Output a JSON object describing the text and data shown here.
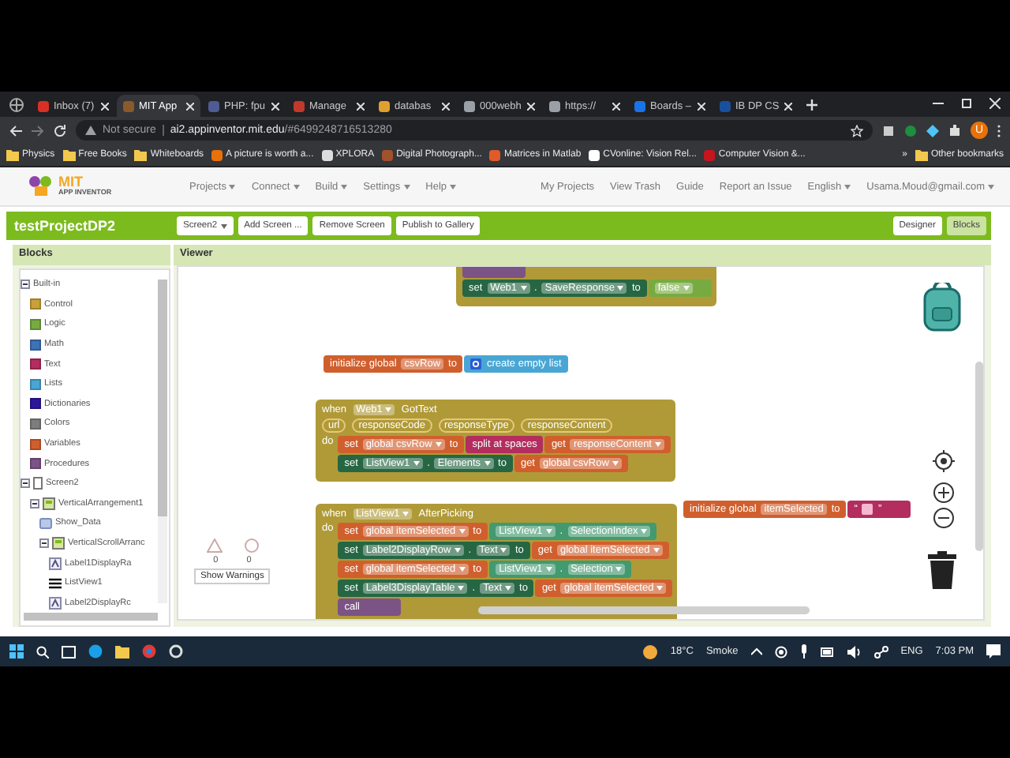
{
  "browser": {
    "tabs": [
      {
        "title": "Inbox (7)",
        "selected": false,
        "color": "#d93025"
      },
      {
        "title": "MIT App",
        "selected": true,
        "color": "#8a5a2b"
      },
      {
        "title": "PHP: fpu",
        "selected": false,
        "color": "#4f5b93"
      },
      {
        "title": "Manage",
        "selected": false,
        "color": "#c0392b"
      },
      {
        "title": "databas",
        "selected": false,
        "color": "#e0a030"
      },
      {
        "title": "000webh",
        "selected": false,
        "color": "#9aa0a6"
      },
      {
        "title": "https://",
        "selected": false,
        "color": "#9aa0a6"
      },
      {
        "title": "Boards –",
        "selected": false,
        "color": "#1a73e8"
      },
      {
        "title": "IB DP CS",
        "selected": false,
        "color": "#1a4f9c"
      }
    ],
    "security": "Not secure",
    "url_host": "ai2.appinventor.mit.edu",
    "url_rest": "/#6499248716513280",
    "profile": "U",
    "bookmarks": [
      {
        "label": "Physics",
        "kind": "folder"
      },
      {
        "label": "Free Books",
        "kind": "folder"
      },
      {
        "label": "Whiteboards",
        "kind": "folder"
      },
      {
        "label": "A picture is worth a...",
        "kind": "site",
        "color": "#e8710a"
      },
      {
        "label": "XPLORA",
        "kind": "site",
        "color": "#dddddd"
      },
      {
        "label": "Digital Photograph...",
        "kind": "site",
        "color": "#a0522d"
      },
      {
        "label": "Matrices in Matlab",
        "kind": "site",
        "color": "#e05a2a"
      },
      {
        "label": "CVonline: Vision Rel...",
        "kind": "site",
        "color": "#ffffff"
      },
      {
        "label": "Computer Vision &...",
        "kind": "site",
        "color": "#c4161c"
      }
    ],
    "more": "»",
    "other": "Other bookmarks"
  },
  "app": {
    "logo_top": "MIT",
    "logo_bottom": "APP INVENTOR",
    "menus": [
      "Projects",
      "Connect",
      "Build",
      "Settings",
      "Help"
    ],
    "links": [
      "My Projects",
      "View Trash",
      "Guide",
      "Report an Issue"
    ],
    "language": "English",
    "account": "Usama.Moud@gmail.com",
    "project": "testProjectDP2",
    "screen": "Screen2",
    "actions": [
      "Add Screen ...",
      "Remove Screen",
      "Publish to Gallery"
    ],
    "modes": [
      {
        "label": "Designer",
        "selected": false
      },
      {
        "label": "Blocks",
        "selected": true
      }
    ]
  },
  "blocks_panel": {
    "title": "Blocks",
    "tree": [
      {
        "label": "Built-in",
        "expanded": true,
        "kind": "root",
        "children": [
          {
            "label": "Control",
            "kind": "category",
            "color": "#c8a13a"
          },
          {
            "label": "Logic",
            "kind": "category",
            "color": "#77ab41"
          },
          {
            "label": "Math",
            "kind": "category",
            "color": "#3f71b5"
          },
          {
            "label": "Text",
            "kind": "category",
            "color": "#b32d5e"
          },
          {
            "label": "Lists",
            "kind": "category",
            "color": "#49a6d4"
          },
          {
            "label": "Dictionaries",
            "kind": "category",
            "color": "#2d1799"
          },
          {
            "label": "Colors",
            "kind": "category",
            "color": "#7d7d7d"
          },
          {
            "label": "Variables",
            "kind": "category",
            "color": "#d05f2d"
          },
          {
            "label": "Procedures",
            "kind": "category",
            "color": "#7c5385"
          }
        ]
      },
      {
        "label": "Screen2",
        "expanded": true,
        "kind": "screen",
        "children": [
          {
            "label": "VerticalArrangement1",
            "expanded": true,
            "kind": "arrangement",
            "children": [
              {
                "label": "Show_Data",
                "kind": "button"
              },
              {
                "label": "VerticalScrollArranc",
                "expanded": true,
                "kind": "arrangement",
                "children": [
                  {
                    "label": "Label1DisplayRa",
                    "kind": "label"
                  },
                  {
                    "label": "ListView1",
                    "kind": "listview"
                  },
                  {
                    "label": "Label2DisplayRc",
                    "kind": "label"
                  }
                ]
              }
            ]
          }
        ]
      }
    ]
  },
  "viewer": {
    "title": "Viewer",
    "warnings": {
      "warning_count": "0",
      "error_count": "0",
      "button": "Show Warnings"
    },
    "blocks": [
      {
        "kind": "event",
        "rows": [
          [
            {
              "kind": "procedure"
            }
          ],
          [
            {
              "kind": "component_set",
              "tokens": [
                {
                  "kind": "label",
                  "text": "set"
                },
                {
                  "kind": "dropdown",
                  "text": "Web1"
                },
                {
                  "kind": "label",
                  "text": "."
                },
                {
                  "kind": "dropdown",
                  "text": "SaveResponse"
                },
                {
                  "kind": "label",
                  "text": "to"
                }
              ]
            },
            {
              "kind": "logic",
              "tokens": [
                {
                  "kind": "dropdown",
                  "text": "false"
                }
              ]
            }
          ]
        ]
      },
      {
        "kind": "global",
        "rows": [
          [
            {
              "kind": "variable",
              "tokens": [
                {
                  "kind": "label",
                  "text": "initialize global"
                },
                {
                  "kind": "field",
                  "text": "csvRow"
                },
                {
                  "kind": "label",
                  "text": "to"
                }
              ]
            },
            {
              "kind": "list",
              "tokens": [
                {
                  "kind": "mutator"
                },
                {
                  "kind": "label",
                  "text": "create empty list"
                }
              ]
            }
          ]
        ]
      },
      {
        "kind": "event",
        "header": [
          {
            "kind": "label",
            "text": "when"
          },
          {
            "kind": "dropdown",
            "text": "Web1"
          },
          {
            "kind": "label",
            "text": "GotText"
          }
        ],
        "params": [
          "url",
          "responseCode",
          "responseType",
          "responseContent"
        ],
        "do_label": "do",
        "rows": [
          [
            {
              "kind": "variable",
              "tokens": [
                {
                  "kind": "label",
                  "text": "set"
                },
                {
                  "kind": "dropdown",
                  "text": "global csvRow"
                },
                {
                  "kind": "label",
                  "text": "to"
                }
              ]
            },
            {
              "kind": "text",
              "tokens": [
                {
                  "kind": "label",
                  "text": "split at spaces"
                }
              ]
            },
            {
              "kind": "variable",
              "tokens": [
                {
                  "kind": "label",
                  "text": "get"
                },
                {
                  "kind": "dropdown",
                  "text": "responseContent"
                }
              ]
            }
          ],
          [
            {
              "kind": "component_set",
              "tokens": [
                {
                  "kind": "label",
                  "text": "set"
                },
                {
                  "kind": "dropdown",
                  "text": "ListView1"
                },
                {
                  "kind": "label",
                  "text": "."
                },
                {
                  "kind": "dropdown",
                  "text": "Elements"
                },
                {
                  "kind": "label",
                  "text": "to"
                }
              ]
            },
            {
              "kind": "variable",
              "tokens": [
                {
                  "kind": "label",
                  "text": "get"
                },
                {
                  "kind": "dropdown",
                  "text": "global csvRow"
                }
              ]
            }
          ]
        ]
      },
      {
        "kind": "event",
        "header": [
          {
            "kind": "label",
            "text": "when"
          },
          {
            "kind": "dropdown",
            "text": "ListView1"
          },
          {
            "kind": "label",
            "text": "AfterPicking"
          }
        ],
        "do_label": "do",
        "rows": [
          [
            {
              "kind": "variable",
              "tokens": [
                {
                  "kind": "label",
                  "text": "set"
                },
                {
                  "kind": "dropdown",
                  "text": "global itemSelected"
                },
                {
                  "kind": "label",
                  "text": "to"
                }
              ]
            },
            {
              "kind": "component_get",
              "tokens": [
                {
                  "kind": "dropdown",
                  "text": "ListView1"
                },
                {
                  "kind": "label",
                  "text": "."
                },
                {
                  "kind": "dropdown",
                  "text": "SelectionIndex"
                }
              ]
            }
          ],
          [
            {
              "kind": "component_set",
              "tokens": [
                {
                  "kind": "label",
                  "text": "set"
                },
                {
                  "kind": "dropdown",
                  "text": "Label2DisplayRow"
                },
                {
                  "kind": "label",
                  "text": "."
                },
                {
                  "kind": "dropdown",
                  "text": "Text"
                },
                {
                  "kind": "label",
                  "text": "to"
                }
              ]
            },
            {
              "kind": "variable",
              "tokens": [
                {
                  "kind": "label",
                  "text": "get"
                },
                {
                  "kind": "dropdown",
                  "text": "global itemSelected"
                }
              ]
            }
          ],
          [
            {
              "kind": "variable",
              "tokens": [
                {
                  "kind": "label",
                  "text": "set"
                },
                {
                  "kind": "dropdown",
                  "text": "global itemSelected"
                },
                {
                  "kind": "label",
                  "text": "to"
                }
              ]
            },
            {
              "kind": "component_get",
              "tokens": [
                {
                  "kind": "dropdown",
                  "text": "ListView1"
                },
                {
                  "kind": "label",
                  "text": "."
                },
                {
                  "kind": "dropdown",
                  "text": "Selection"
                }
              ]
            }
          ],
          [
            {
              "kind": "component_set",
              "tokens": [
                {
                  "kind": "label",
                  "text": "set"
                },
                {
                  "kind": "dropdown",
                  "text": "Label3DisplayTable"
                },
                {
                  "kind": "label",
                  "text": "."
                },
                {
                  "kind": "dropdown",
                  "text": "Text"
                },
                {
                  "kind": "label",
                  "text": "to"
                }
              ]
            },
            {
              "kind": "variable",
              "tokens": [
                {
                  "kind": "label",
                  "text": "get"
                },
                {
                  "kind": "dropdown",
                  "text": "global itemSelected"
                }
              ]
            }
          ],
          [
            {
              "kind": "procedure",
              "tokens": [
                {
                  "kind": "label",
                  "text": "call"
                }
              ]
            }
          ]
        ]
      },
      {
        "kind": "global",
        "rows": [
          [
            {
              "kind": "variable",
              "tokens": [
                {
                  "kind": "label",
                  "text": "initialize global"
                },
                {
                  "kind": "field",
                  "text": "itemSelected"
                },
                {
                  "kind": "label",
                  "text": "to"
                }
              ]
            },
            {
              "kind": "text",
              "tokens": [
                {
                  "kind": "label",
                  "text": "“"
                },
                {
                  "kind": "empty"
                },
                {
                  "kind": "label",
                  "text": "”"
                }
              ]
            }
          ]
        ]
      }
    ]
  },
  "taskbar": {
    "temperature": "18°C",
    "weather": "Smoke",
    "language": "ENG",
    "time": "7:03 PM"
  }
}
